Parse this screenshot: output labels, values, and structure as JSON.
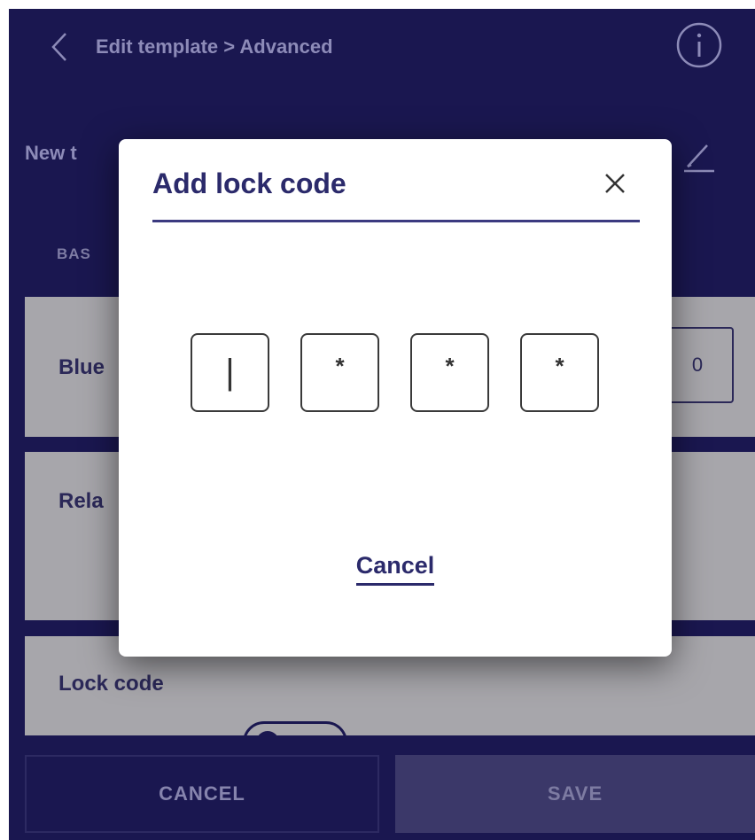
{
  "header": {
    "title": "Edit template > Advanced",
    "back_icon": "chevron-left-icon",
    "info_icon": "info-icon"
  },
  "template": {
    "name_visible": "New t",
    "edit_icon": "pencil-icon"
  },
  "section": {
    "label_visible": "BAS"
  },
  "cards": {
    "bluetooth_label": "Blue",
    "bluetooth_value_visible": "0",
    "relay_label": "Rela",
    "lock_code_label": "Lock code"
  },
  "bottom_bar": {
    "cancel_label": "CANCEL",
    "save_label": "SAVE"
  },
  "modal": {
    "title": "Add lock code",
    "close_icon": "close-icon",
    "code_digits": [
      "|",
      "*",
      "*",
      "*"
    ],
    "cancel_label": "Cancel"
  },
  "colors": {
    "app_background": "#1a1750",
    "card_background": "#a7a6ab",
    "modal_accent": "#2b2a6b"
  }
}
